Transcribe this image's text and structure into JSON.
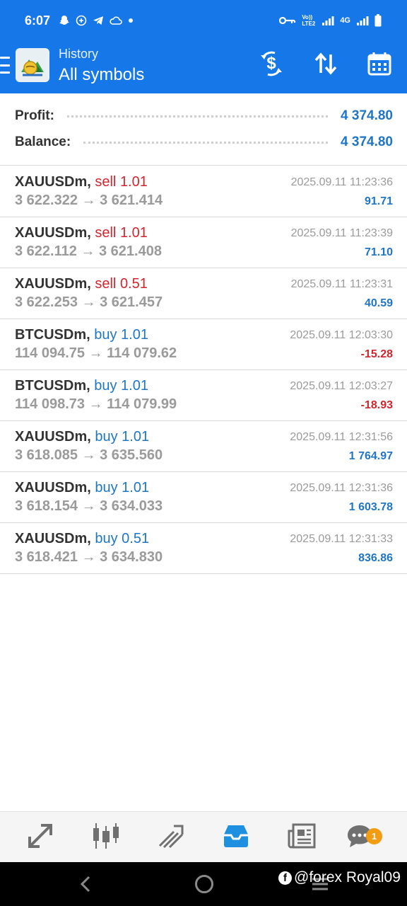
{
  "status_bar": {
    "time": "6:07",
    "left_icons": [
      "snapchat-icon",
      "add-circle-icon",
      "telegram-icon",
      "cloud-icon",
      "dot-icon"
    ],
    "volte_label": "Vo)) LTE2",
    "network_label": "4G",
    "right_icons": [
      "key-icon",
      "signal-icon",
      "battery-icon"
    ]
  },
  "app_bar": {
    "subtitle": "History",
    "title": "All symbols",
    "actions": [
      "currency-exchange-icon",
      "sort-icon",
      "calendar-icon"
    ]
  },
  "summary": {
    "profit_label": "Profit:",
    "profit_value": "4 374.80",
    "balance_label": "Balance:",
    "balance_value": "4 374.80"
  },
  "deals": [
    {
      "symbol": "XAUUSDm,",
      "action": "sell",
      "volume": "1.01",
      "open": "3 622.322",
      "close": "3 621.414",
      "time": "2025.09.11 11:23:36",
      "profit": "91.71",
      "profit_sign": "pos"
    },
    {
      "symbol": "XAUUSDm,",
      "action": "sell",
      "volume": "1.01",
      "open": "3 622.112",
      "close": "3 621.408",
      "time": "2025.09.11 11:23:39",
      "profit": "71.10",
      "profit_sign": "pos"
    },
    {
      "symbol": "XAUUSDm,",
      "action": "sell",
      "volume": "0.51",
      "open": "3 622.253",
      "close": "3 621.457",
      "time": "2025.09.11 11:23:31",
      "profit": "40.59",
      "profit_sign": "pos"
    },
    {
      "symbol": "BTCUSDm,",
      "action": "buy",
      "volume": "1.01",
      "open": "114 094.75",
      "close": "114 079.62",
      "time": "2025.09.11 12:03:30",
      "profit": "-15.28",
      "profit_sign": "neg"
    },
    {
      "symbol": "BTCUSDm,",
      "action": "buy",
      "volume": "1.01",
      "open": "114 098.73",
      "close": "114 079.99",
      "time": "2025.09.11 12:03:27",
      "profit": "-18.93",
      "profit_sign": "neg"
    },
    {
      "symbol": "XAUUSDm,",
      "action": "buy",
      "volume": "1.01",
      "open": "3 618.085",
      "close": "3 635.560",
      "time": "2025.09.11 12:31:56",
      "profit": "1 764.97",
      "profit_sign": "pos"
    },
    {
      "symbol": "XAUUSDm,",
      "action": "buy",
      "volume": "1.01",
      "open": "3 618.154",
      "close": "3 634.033",
      "time": "2025.09.11 12:31:36",
      "profit": "1 603.78",
      "profit_sign": "pos"
    },
    {
      "symbol": "XAUUSDm,",
      "action": "buy",
      "volume": "0.51",
      "open": "3 618.421",
      "close": "3 634.830",
      "time": "2025.09.11 12:31:33",
      "profit": "836.86",
      "profit_sign": "pos"
    }
  ],
  "bottom_nav": {
    "items": [
      "quotes-icon",
      "chart-icon",
      "trade-icon",
      "history-icon",
      "news-icon",
      "chat-icon"
    ],
    "active": "history-icon",
    "chat_badge": "1"
  },
  "watermark": {
    "platform_icon": "facebook-icon",
    "text": "@forex Royal09"
  },
  "colors": {
    "header": "#1677e8",
    "profit_positive": "#1f76c6",
    "profit_negative": "#d0262d",
    "sell": "#d0262d",
    "buy": "#1f76c6",
    "badge": "#f39c12"
  }
}
